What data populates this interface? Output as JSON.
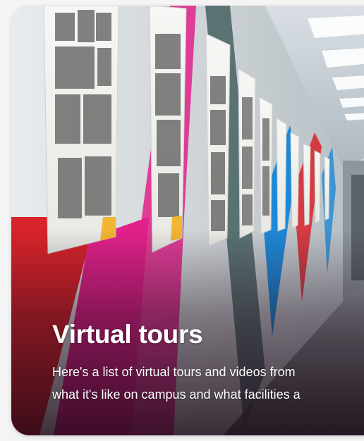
{
  "card": {
    "title": "Virtual tours",
    "description_lines": [
      "Here's a list of virtual tours and videos from",
      "what it's like on campus and what facilities a"
    ]
  },
  "image": {
    "subject": "corridor-with-wall-posters-photo"
  },
  "colors": {
    "text": "#ffffff",
    "overlay_dark": "#1e0a19",
    "stripe_pink": "#e0218a",
    "stripe_red": "#d8232a",
    "stripe_blue": "#1e88d6",
    "stripe_yellow": "#f2b632",
    "stripe_grey": "#3e5a5a"
  }
}
